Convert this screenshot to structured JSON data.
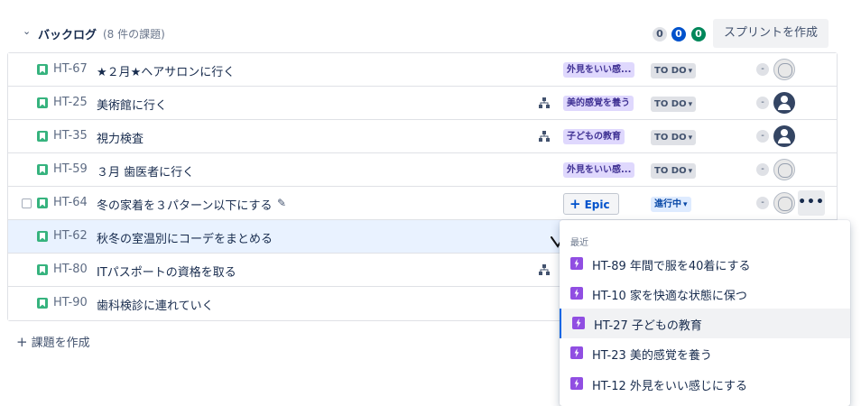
{
  "backlog": {
    "collapse_glyph": "⌄",
    "title": "バックログ",
    "count": "(8 件の課題)",
    "badges": {
      "todo": "0",
      "in_progress": "0",
      "done": "0"
    },
    "create_sprint": "スプリントを作成"
  },
  "issues": [
    {
      "key": "HT-67",
      "summary": "★２月★ヘアサロンに行く",
      "epic": "外見をいい感...",
      "status": "TO DO",
      "estimate": "-",
      "avatar": "placeholder"
    },
    {
      "key": "HT-25",
      "summary": "美術館に行く",
      "epic": "美的感覚を養う",
      "status": "TO DO",
      "estimate": "-",
      "avatar": "user",
      "has_child": true
    },
    {
      "key": "HT-35",
      "summary": "視力検査",
      "epic": "子どもの教育",
      "status": "TO DO",
      "estimate": "-",
      "avatar": "user",
      "has_child": true
    },
    {
      "key": "HT-59",
      "summary": "３月 歯医者に行く",
      "epic": "外見をいい感...",
      "status": "TO DO",
      "estimate": "-",
      "avatar": "placeholder"
    },
    {
      "key": "HT-64",
      "summary": "冬の家着を３パターン以下にする",
      "epic_button": "Epic",
      "status": "進行中",
      "estimate": "-",
      "avatar": "placeholder",
      "more": "•••"
    },
    {
      "key": "HT-62",
      "summary": "秋冬の室温別にコーデをまとめる"
    },
    {
      "key": "HT-80",
      "summary": "ITパスポートの資格を取る",
      "has_child": true
    },
    {
      "key": "HT-90",
      "summary": "歯科検診に連れていく"
    }
  ],
  "create_issue": "課題を作成",
  "epic_dropdown": {
    "heading": "最近",
    "items": [
      {
        "label": "HT-89 年間で服を40着にする"
      },
      {
        "label": "HT-10 家を快適な状態に保つ"
      },
      {
        "label": "HT-27 子どもの教育",
        "active": true
      },
      {
        "label": "HT-23 美的感覚を養う"
      },
      {
        "label": "HT-12 外見をいい感じにする"
      }
    ]
  },
  "colors": {
    "story": "#36b37e",
    "epic": "#904ee2",
    "selected_row": "#e9f2ff",
    "accent": "#0052cc",
    "done": "#00875a"
  },
  "icons": {
    "story": "bookmark-icon",
    "epic": "lightning-icon",
    "child_issues": "hierarchy-icon",
    "edit": "pencil-icon",
    "more": "ellipsis-icon"
  }
}
